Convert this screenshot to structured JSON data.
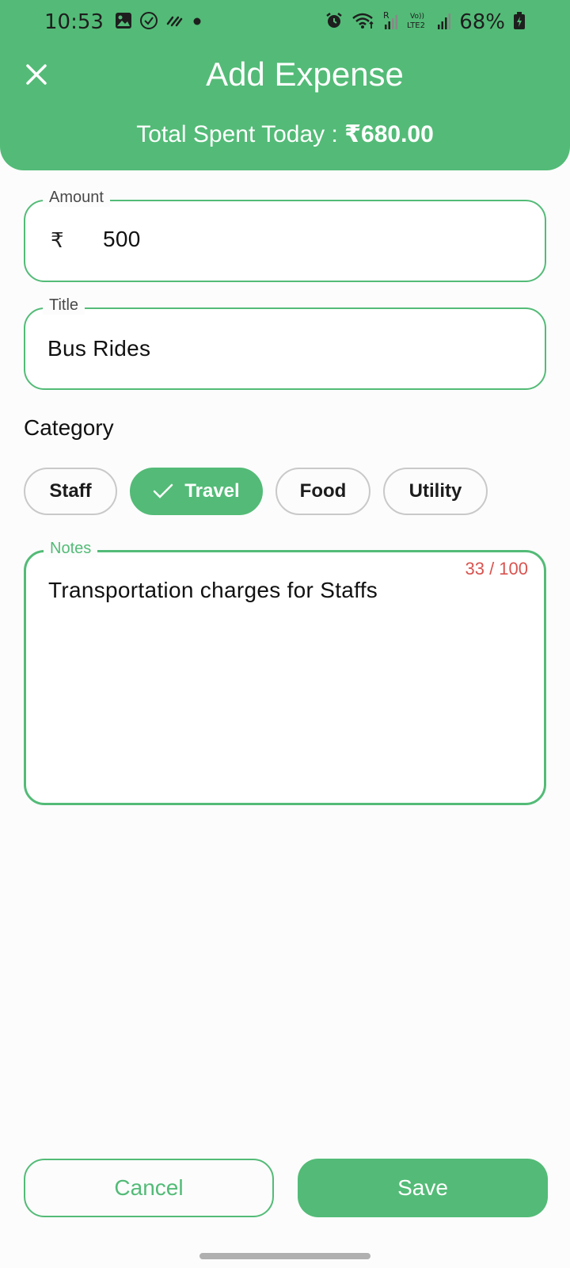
{
  "status_bar": {
    "time": "10:53",
    "battery": "68%",
    "left_icons": [
      "gallery-icon",
      "check-circle-icon",
      "signal-waves-icon",
      "dot-icon"
    ],
    "right_icons": [
      "alarm-icon",
      "wifi-icon",
      "signal-icon",
      "volte-icon",
      "signal-icon",
      "battery-icon"
    ]
  },
  "header": {
    "title": "Add Expense",
    "subtitle_label": "Total Spent Today : ",
    "subtitle_amount": "₹680.00",
    "close_icon": "close-icon"
  },
  "form": {
    "amount": {
      "label": "Amount",
      "prefix": "₹",
      "value": "500"
    },
    "title": {
      "label": "Title",
      "value": "Bus Rides"
    },
    "category": {
      "label": "Category",
      "chips": [
        {
          "label": "Staff",
          "selected": false
        },
        {
          "label": "Travel",
          "selected": true
        },
        {
          "label": "Food",
          "selected": false
        },
        {
          "label": "Utility",
          "selected": false
        }
      ]
    },
    "notes": {
      "label": "Notes",
      "value": "Transportation charges for Staffs",
      "counter": "33 / 100"
    }
  },
  "actions": {
    "cancel_label": "Cancel",
    "save_label": "Save"
  },
  "colors": {
    "accent": "#53bb77",
    "counter": "#d9534f",
    "chip_border": "#c9c9c9"
  }
}
